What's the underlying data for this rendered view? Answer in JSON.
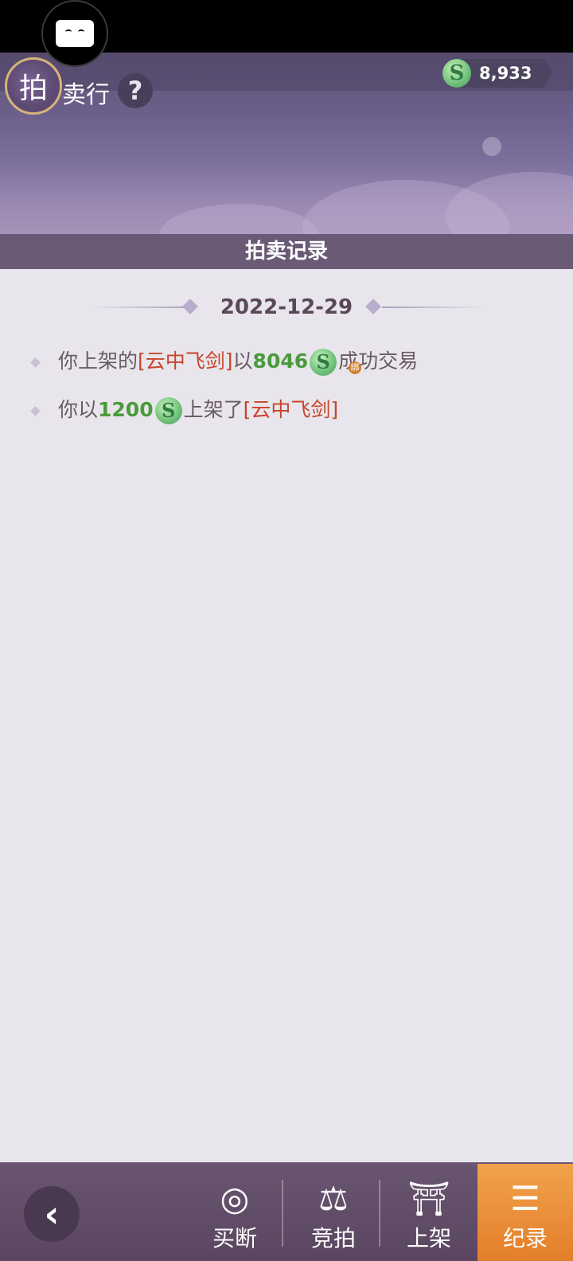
{
  "header": {
    "logo_char": "拍",
    "logo_rest": "卖行",
    "help_label": "?",
    "currency_value": "8,933"
  },
  "section_title": "拍卖记录",
  "date": "2022-12-29",
  "records": [
    {
      "pre": "你上架的",
      "item": "[云中飞剑]",
      "mid": "以",
      "amount": "8046",
      "badge": "绑",
      "post": "成功交易"
    },
    {
      "pre": "你以",
      "amount": "1200",
      "mid": "上架了",
      "item": "[云中飞剑]"
    }
  ],
  "nav": {
    "back_label": "‹",
    "items": [
      {
        "label": "买断",
        "icon": "buyout-icon"
      },
      {
        "label": "竞拍",
        "icon": "scale-icon"
      },
      {
        "label": "上架",
        "icon": "shop-icon"
      },
      {
        "label": "纪录",
        "icon": "record-list-icon"
      }
    ]
  },
  "colors": {
    "active_tab": "#e37e2a",
    "item_name": "#c8452c",
    "amount": "#4a9a3c"
  }
}
